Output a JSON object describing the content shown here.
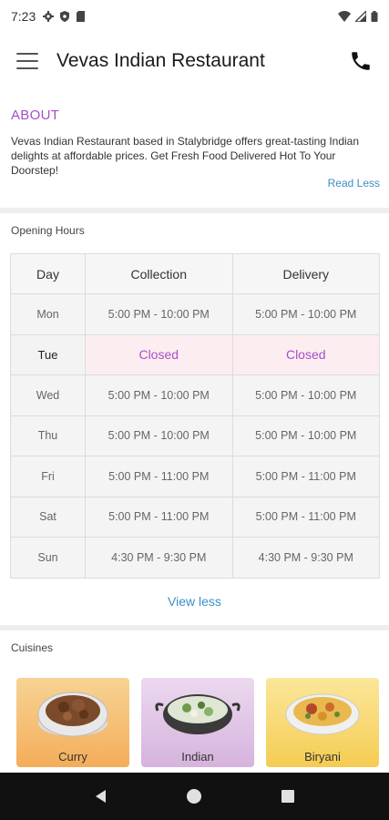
{
  "status_bar": {
    "time": "7:23"
  },
  "app_bar": {
    "title": "Vevas Indian Restaurant"
  },
  "about": {
    "heading": "ABOUT",
    "text": "Vevas Indian Restaurant based in Stalybridge offers great-tasting Indian delights at affordable prices. Get Fresh Food Delivered Hot To Your Doorstep!",
    "read_less": "Read Less"
  },
  "opening_hours": {
    "heading": "Opening Hours",
    "columns": [
      "Day",
      "Collection",
      "Delivery"
    ],
    "rows": [
      {
        "day": "Mon",
        "collection": "5:00 PM - 10:00 PM",
        "delivery": "5:00 PM - 10:00 PM"
      },
      {
        "day": "Tue",
        "collection": "Closed",
        "delivery": "Closed"
      },
      {
        "day": "Wed",
        "collection": "5:00 PM - 10:00 PM",
        "delivery": "5:00 PM - 10:00 PM"
      },
      {
        "day": "Thu",
        "collection": "5:00 PM - 10:00 PM",
        "delivery": "5:00 PM - 10:00 PM"
      },
      {
        "day": "Fri",
        "collection": "5:00 PM - 11:00 PM",
        "delivery": "5:00 PM - 11:00 PM"
      },
      {
        "day": "Sat",
        "collection": "5:00 PM - 11:00 PM",
        "delivery": "5:00 PM - 11:00 PM"
      },
      {
        "day": "Sun",
        "collection": "4:30 PM - 9:30 PM",
        "delivery": "4:30 PM - 9:30 PM"
      }
    ],
    "view_less": "View less"
  },
  "cuisines": {
    "heading": "Cuisines",
    "items": [
      {
        "label": "Curry"
      },
      {
        "label": "Indian"
      },
      {
        "label": "Biryani"
      }
    ]
  },
  "colors": {
    "accent": "#a64fc7",
    "link": "#3a8fc7",
    "closed_row_bg": "#fcedf0"
  }
}
